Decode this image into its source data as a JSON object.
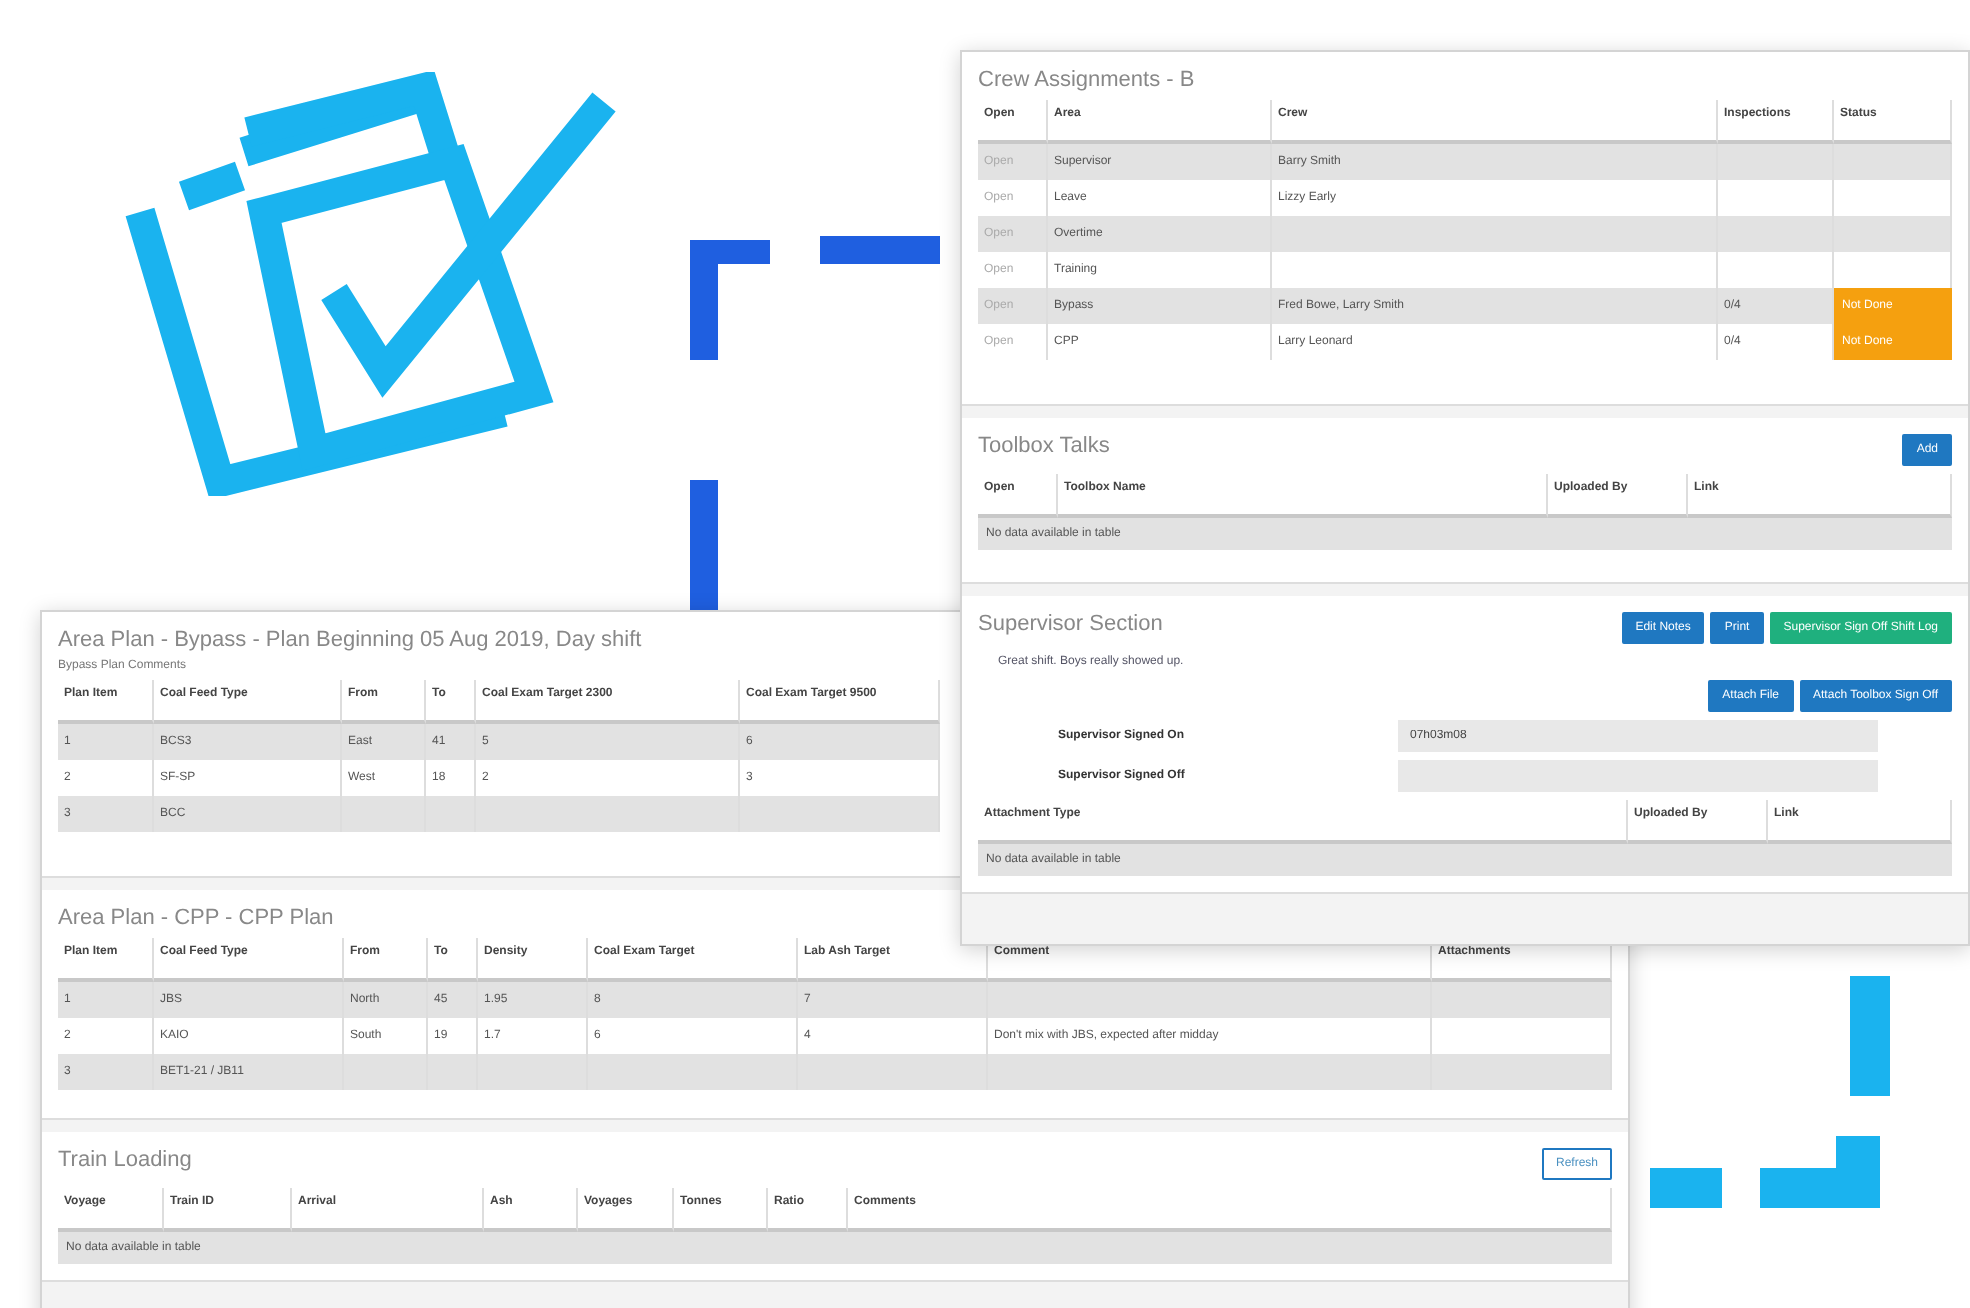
{
  "crew": {
    "title": "Crew Assignments - B",
    "columns": [
      "Open",
      "Area",
      "Crew",
      "Inspections",
      "Status"
    ],
    "rows": [
      {
        "open": "Open",
        "area": "Supervisor",
        "crew": "Barry Smith"
      },
      {
        "open": "Open",
        "area": "Leave",
        "crew": "Lizzy Early"
      },
      {
        "open": "Open",
        "area": "Overtime"
      },
      {
        "open": "Open",
        "area": "Training"
      },
      {
        "open": "Open",
        "area": "Bypass",
        "crew": "Fred Bowe, Larry Smith",
        "inspections": "0/4",
        "status": "Not Done",
        "color": "#f5a00f"
      },
      {
        "open": "Open",
        "area": "CPP",
        "crew": "Larry Leonard",
        "inspections": "0/4",
        "status": "Not Done",
        "color": "#f5a00f"
      }
    ]
  },
  "toolbox": {
    "title": "Toolbox Talks",
    "add_button": "Add",
    "columns": [
      "Open",
      "Toolbox Name",
      "Uploaded By",
      "Link"
    ],
    "empty": "No data available in table"
  },
  "supervisor": {
    "title": "Supervisor Section",
    "buttons": [
      {
        "label": "Edit Notes",
        "kind": "primary"
      },
      {
        "label": "Print",
        "kind": "primary"
      },
      {
        "label": "Supervisor Sign Off Shift Log",
        "kind": "success"
      }
    ],
    "notes": "Great shift. Boys really showed up.",
    "attach_buttons": [
      "Attach File",
      "Attach Toolbox Sign Off"
    ],
    "fields": [
      {
        "label": "Supervisor Signed On",
        "value": "07h03m08"
      },
      {
        "label": "Supervisor Signed Off"
      }
    ],
    "columns": [
      "Attachment Type",
      "Uploaded By",
      "Link"
    ],
    "empty": "No data available in table"
  },
  "bypass": {
    "title": "Area Plan - Bypass - Plan Beginning 05 Aug 2019, Day shift",
    "subtitle": "Bypass Plan Comments",
    "columns": [
      "Plan Item",
      "Coal Feed Type",
      "From",
      "To",
      "Coal Exam Target 2300",
      "Coal Exam Target 9500"
    ],
    "rows": [
      [
        "1",
        "BCS3",
        "East",
        "41",
        "5",
        "6"
      ],
      [
        "2",
        "SF-SP",
        "West",
        "18",
        "2",
        "3"
      ],
      [
        "3",
        "BCC",
        null,
        null,
        null,
        null
      ]
    ]
  },
  "cpp": {
    "title": "Area Plan - CPP - CPP Plan",
    "columns": [
      "Plan Item",
      "Coal Feed Type",
      "From",
      "To",
      "Density",
      "Coal Exam Target",
      "Lab Ash Target",
      "Comment",
      "Attachments"
    ],
    "rows": [
      [
        "1",
        "JBS",
        "North",
        "45",
        "1.95",
        "8",
        "7",
        null,
        null
      ],
      [
        "2",
        "KAIO",
        "South",
        "19",
        "1.7",
        "6",
        "4",
        "Don't mix with JBS, expected after midday",
        null
      ],
      [
        "3",
        "BET1-21 / JB11",
        null,
        null,
        null,
        null,
        null,
        null,
        null
      ]
    ]
  },
  "train": {
    "title": "Train Loading",
    "refresh_button": "Refresh",
    "columns": [
      "Voyage",
      "Train ID",
      "Arrival",
      "Ash",
      "Voyages",
      "Tonnes",
      "Ratio",
      "Comments"
    ],
    "empty": "No data available in table"
  }
}
